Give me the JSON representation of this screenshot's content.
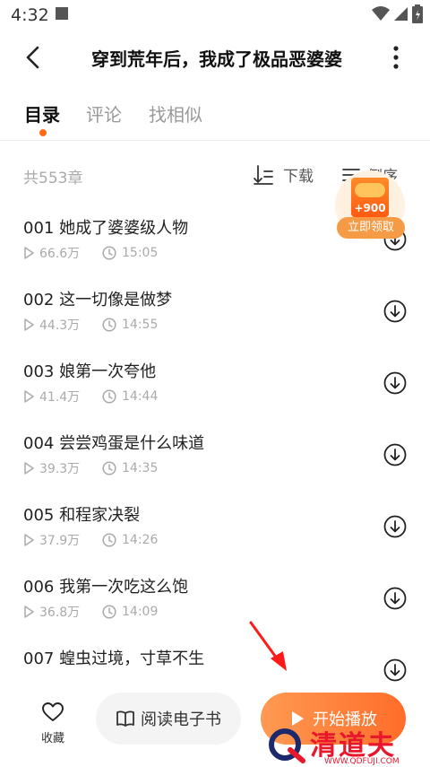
{
  "status_bar": {
    "time": "4:32"
  },
  "header": {
    "title": "穿到荒年后，我成了极品恶婆婆"
  },
  "tabs": [
    {
      "label": "目录",
      "active": true
    },
    {
      "label": "评论",
      "active": false
    },
    {
      "label": "找相似",
      "active": false
    }
  ],
  "list_header": {
    "count": "共553章",
    "download_label": "下载",
    "sort_label": "倒序"
  },
  "chapters": [
    {
      "title": "001 她成了婆婆级人物",
      "plays": "66.6万",
      "duration": "15:05"
    },
    {
      "title": "002 这一切像是做梦",
      "plays": "44.3万",
      "duration": "14:55"
    },
    {
      "title": "003 娘第一次夸他",
      "plays": "41.4万",
      "duration": "14:44"
    },
    {
      "title": "004 尝尝鸡蛋是什么味道",
      "plays": "39.3万",
      "duration": "14:35"
    },
    {
      "title": "005 和程家决裂",
      "plays": "37.9万",
      "duration": "14:26"
    },
    {
      "title": "006 我第一次吃这么饱",
      "plays": "36.8万",
      "duration": "14:09"
    },
    {
      "title": "007 蝗虫过境，寸草不生",
      "plays": "",
      "duration": ""
    }
  ],
  "reward": {
    "amount": "+900",
    "button_label": "立即领取"
  },
  "bottom_bar": {
    "favorite_label": "收藏",
    "read_ebook_label": "阅读电子书",
    "play_label": "开始播放"
  },
  "watermark": {
    "brand": "清道夫",
    "url": "WWW.QDFUJI.COM"
  },
  "colors": {
    "accent": "#ff6a1a",
    "play_button": "#ff7a35",
    "watermark": "#e8172c"
  }
}
